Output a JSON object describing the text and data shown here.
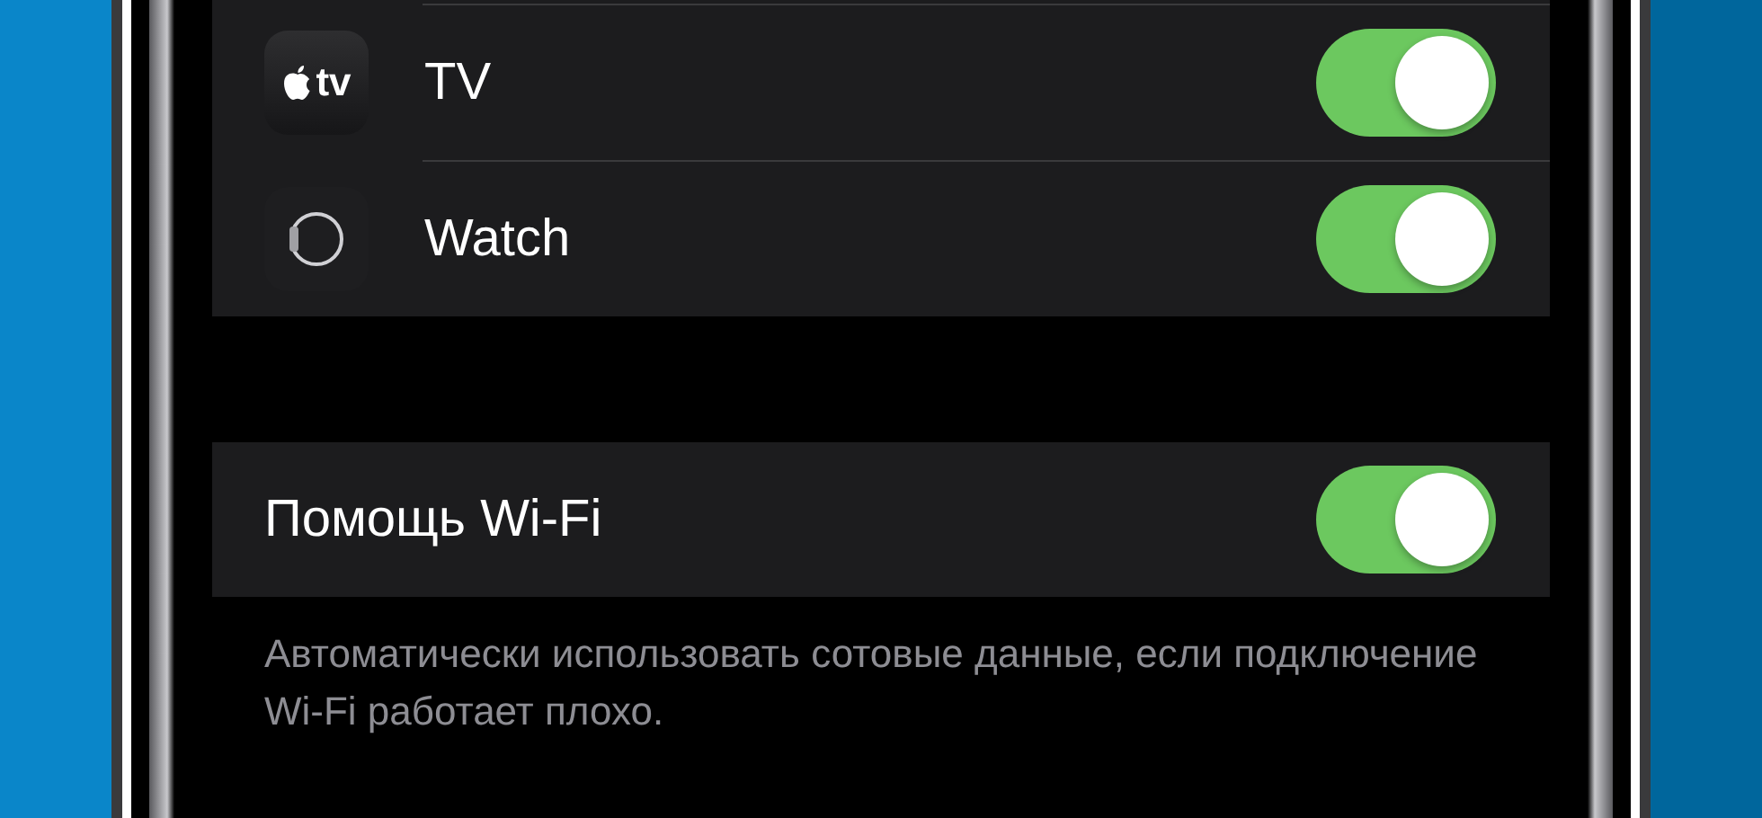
{
  "apps": [
    {
      "kind": "tv",
      "icon_text": "tv",
      "label": "TV",
      "on": true
    },
    {
      "kind": "watch",
      "label": "Watch",
      "on": true
    }
  ],
  "wifi_assist": {
    "label": "Помощь Wi-Fi",
    "on": true
  },
  "footer": "Автоматически использовать сотовые данные, если подключение Wi-Fi работает плохо."
}
